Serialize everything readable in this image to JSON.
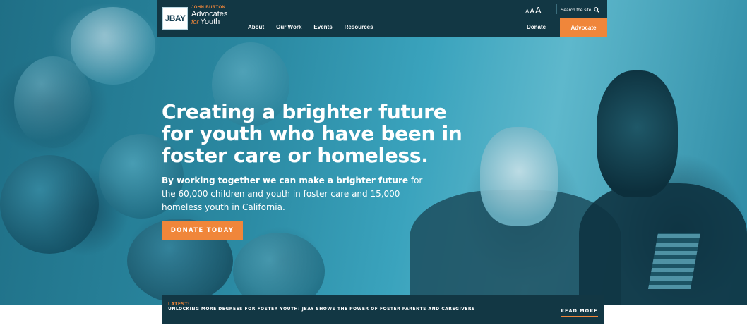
{
  "nav": {
    "logo": {
      "mark": "JBAY",
      "top_line": "JOHN BURTON",
      "mid_line": "Advocates",
      "for_text": "for",
      "bottom_word": "Youth"
    },
    "menu_items": [
      "About",
      "Our Work",
      "Events",
      "Resources"
    ],
    "donate_label": "Donate",
    "advocate_label": "Advocate",
    "font_size_labels": [
      "A",
      "A",
      "A"
    ],
    "search_label": "Search the site"
  },
  "hero": {
    "headline": "Creating a brighter future for youth who have been in foster care or homeless.",
    "subtext_bold": "By working together we can make a brighter future",
    "subtext_rest": " for the 60,000 children and youth in foster care and 15,000 homeless youth in California.",
    "cta_label": "DONATE TODAY"
  },
  "latest": {
    "label": "LATEST:",
    "title": "UNLOCKING MORE DEGREES FOR FOSTER YOUTH: JBAY SHOWS THE POWER OF FOSTER PARENTS AND CAREGIVERS",
    "read_more": "READ MORE"
  },
  "colors": {
    "navy": "#123744",
    "orange": "#f0863a",
    "teal": "#2b8aa3"
  }
}
